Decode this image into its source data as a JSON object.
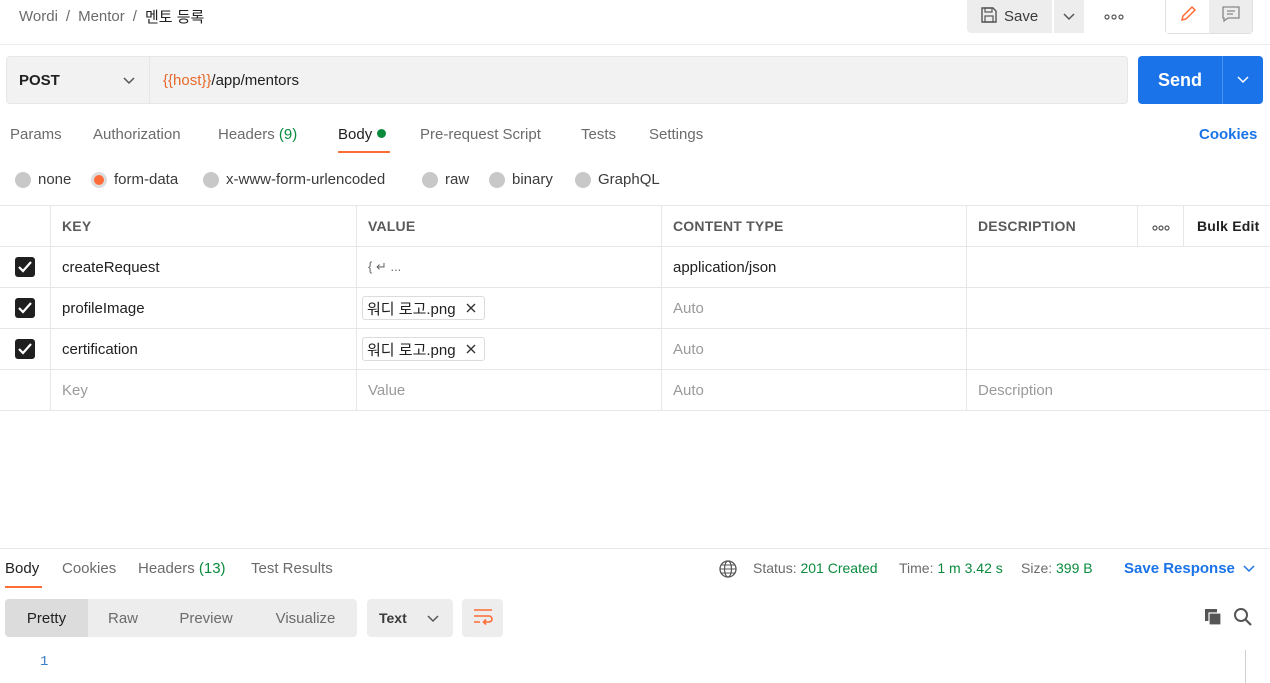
{
  "breadcrumb": {
    "workspace": "Wordi",
    "collection": "Mentor",
    "request": "멘토 등록",
    "sep1": "/",
    "sep2": "/"
  },
  "toolbar": {
    "save_label": "Save"
  },
  "request": {
    "method": "POST",
    "url_var": "{{host}}",
    "url_path": "/app/mentors",
    "send_label": "Send"
  },
  "tabs": {
    "params": "Params",
    "authorization": "Authorization",
    "headers": "Headers",
    "headers_count": "(9)",
    "body": "Body",
    "prerequest": "Pre-request Script",
    "tests": "Tests",
    "settings": "Settings",
    "cookies": "Cookies"
  },
  "body_types": {
    "none": "none",
    "form_data": "form-data",
    "urlencoded": "x-www-form-urlencoded",
    "raw": "raw",
    "binary": "binary",
    "graphql": "GraphQL",
    "selected": "form-data"
  },
  "table": {
    "headers": {
      "key": "KEY",
      "value": "VALUE",
      "content_type": "CONTENT TYPE",
      "description": "DESCRIPTION",
      "bulk_edit": "Bulk Edit"
    },
    "rows": [
      {
        "key": "createRequest",
        "value": "{ ↵ ...",
        "content_type": "application/json",
        "checked": true
      },
      {
        "key": "profileImage",
        "value": "워디 로고.png",
        "content_type": "Auto",
        "checked": true
      },
      {
        "key": "certification",
        "value": "워디 로고.png",
        "content_type": "Auto",
        "checked": true
      }
    ],
    "placeholder": {
      "key": "Key",
      "value": "Value",
      "content_type": "Auto",
      "description": "Description"
    }
  },
  "response": {
    "tabs": {
      "body": "Body",
      "cookies": "Cookies",
      "headers": "Headers",
      "headers_count": "(13)",
      "test_results": "Test Results"
    },
    "status_label": "Status:",
    "status_value": "201 Created",
    "time_label": "Time:",
    "time_value": "1 m 3.42 s",
    "size_label": "Size:",
    "size_value": "399 B",
    "save_response": "Save Response",
    "views": {
      "pretty": "Pretty",
      "raw": "Raw",
      "preview": "Preview",
      "visualize": "Visualize"
    },
    "format": "Text",
    "line_number": "1"
  },
  "colors": {
    "accent": "#ff6c37",
    "primary": "#1a73e8",
    "success": "#0a8a3d"
  }
}
